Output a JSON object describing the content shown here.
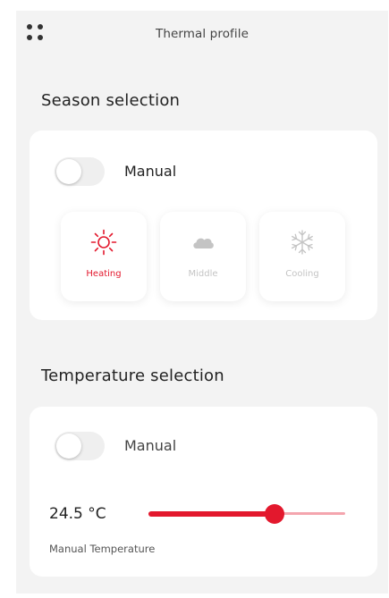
{
  "app": {
    "title": "Thermal profile",
    "menu_icon": "grid-dots-icon"
  },
  "colors": {
    "accent": "#e3182d",
    "accent_light": "#f4a5ae",
    "inactive": "#c4c4c4",
    "screen_background": "#f3f3f3",
    "card_background": "#ffffff",
    "toggle_off": "#efefef"
  },
  "season": {
    "section_title": "Season selection",
    "toggle": {
      "label": "Manual",
      "on": false
    },
    "options": [
      {
        "label": "Heating",
        "icon": "sun-icon",
        "selected": true
      },
      {
        "label": "Middle",
        "icon": "cloud-icon",
        "selected": false
      },
      {
        "label": "Cooling",
        "icon": "snowflake-icon",
        "selected": false
      }
    ]
  },
  "temperature": {
    "section_title": "Temperature selection",
    "toggle": {
      "label": "Manual",
      "on": false
    },
    "value_text": "24.5 °C",
    "caption": "Manual Temperature",
    "slider_fraction": 0.64
  }
}
